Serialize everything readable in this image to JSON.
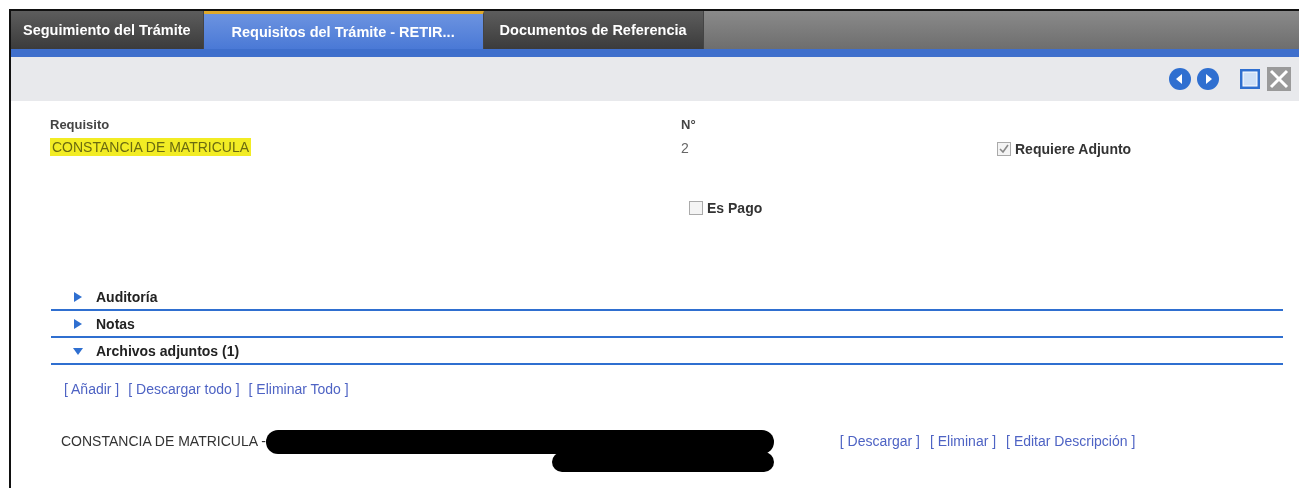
{
  "tabs": [
    {
      "label": "Seguimiento del Trámite",
      "selected": false
    },
    {
      "label": "Requisitos del Trámite - RETIR...",
      "selected": true
    },
    {
      "label": "Documentos de Referencia",
      "selected": false
    }
  ],
  "form": {
    "requisito": {
      "label": "Requisito",
      "value": "CONSTANCIA DE MATRICULA",
      "highlighted": true
    },
    "numero": {
      "label": "N°",
      "value": "2"
    },
    "requiere_adjunto": {
      "label": "Requiere Adjunto",
      "checked": true
    },
    "es_pago": {
      "label": "Es Pago",
      "checked": false
    }
  },
  "sections": [
    {
      "title": "Auditoría",
      "expanded": false
    },
    {
      "title": "Notas",
      "expanded": false
    },
    {
      "title": "Archivos adjuntos (1)",
      "expanded": true
    }
  ],
  "attachment_actions": [
    "[ Añadir ]",
    "[ Descargar todo ]",
    "[ Eliminar Todo ]"
  ],
  "attachments": [
    {
      "name": "CONSTANCIA DE MATRICULA -",
      "actions": [
        "[ Descargar ]",
        "[ Eliminar ]",
        "[ Editar Descripción ]"
      ]
    }
  ]
}
